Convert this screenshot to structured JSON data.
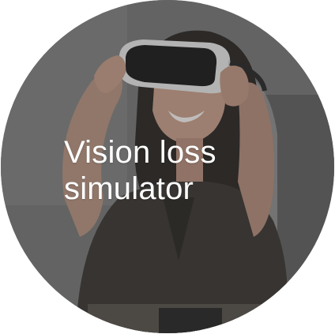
{
  "tile": {
    "title_line_1": "Vision loss",
    "title_line_2": "simulator"
  },
  "image": {
    "subject": "person-wearing-vr-headset"
  },
  "colors": {
    "text": "#ffffff",
    "overlay": "#282828"
  }
}
